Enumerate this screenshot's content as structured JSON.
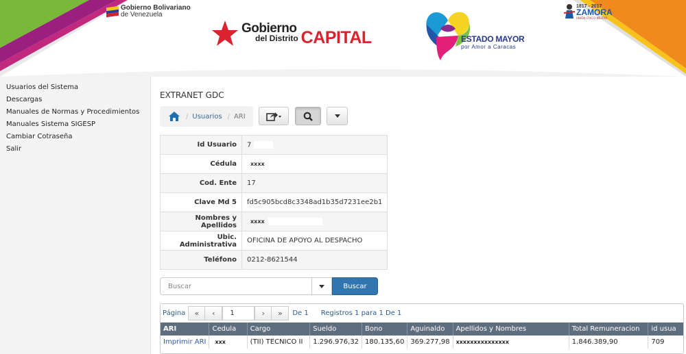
{
  "header": {
    "gob_bolivariano_line1": "Gobierno Bolivariano",
    "gob_bolivariano_line2": "de Venezuela",
    "gdc_line1": "Gobierno",
    "gdc_line2": "del Distrito",
    "gdc_capital": "CAPITAL",
    "estado_mayor_title": "ESTADO MAYOR",
    "estado_mayor_sub": "por Amor a Caracas",
    "zamora_years": "1817 - 2017",
    "zamora_name": "ZAMORA",
    "zamora_sub": "UNIÓN CÍVICO MILITAR"
  },
  "sidebar": {
    "items": [
      {
        "label": "Usuarios del Sistema"
      },
      {
        "label": "Descargas"
      },
      {
        "label": "Manuales de Normas y Procedimientos"
      },
      {
        "label": "Manuales Sistema SIGESP"
      },
      {
        "label": "Cambiar Cotraseña"
      },
      {
        "label": "Salir"
      }
    ]
  },
  "main": {
    "title": "EXTRANET GDC",
    "breadcrumb": {
      "home_icon": "home-icon",
      "link": "Usuarios",
      "current": "ARI"
    },
    "toolbar": {
      "export_icon": "share-icon",
      "search_icon": "search-icon",
      "dropdown_icon": "caret-down-icon"
    }
  },
  "detail": {
    "rows": [
      {
        "label": "Id Usuario",
        "value": "7"
      },
      {
        "label": "Cédula",
        "value": "xxxx"
      },
      {
        "label": "Cod. Ente",
        "value": "17"
      },
      {
        "label": "Clave Md 5",
        "value": "fd5c905bcd8c3348ad1b35d7231ee2b1"
      },
      {
        "label": "Nombres y Apellidos",
        "value": "xxxx"
      },
      {
        "label": "Ubic. Administrativa",
        "value": "OFICINA DE APOYO AL DESPACHO"
      },
      {
        "label": "Teléfono",
        "value": "0212-8621544"
      }
    ]
  },
  "search": {
    "placeholder": "Buscar",
    "button_label": "Buscar"
  },
  "grid": {
    "pager": {
      "label": "Página",
      "page": "1",
      "of": "De 1",
      "records": "Registros 1 para 1 De 1"
    },
    "columns": [
      "ARI",
      "Cedula",
      "Cargo",
      "Sueldo",
      "Bono",
      "Aguinaldo",
      "Apellidos y Nombres",
      "Total Remuneracion",
      "id usua"
    ],
    "rows": [
      [
        "Imprimir ARI",
        "xxx",
        "(TII) TECNICO II",
        "1.296.976,32",
        "180.135,60",
        "369.277,98",
        "xxxxxxxxxxxxxxx",
        "1.846.389,90",
        "709"
      ]
    ]
  },
  "colors": {
    "capital_red": "#d9232e",
    "button_blue": "#3276b1",
    "grid_header": "#5e6e7e",
    "link_blue": "#2a5a9a"
  }
}
